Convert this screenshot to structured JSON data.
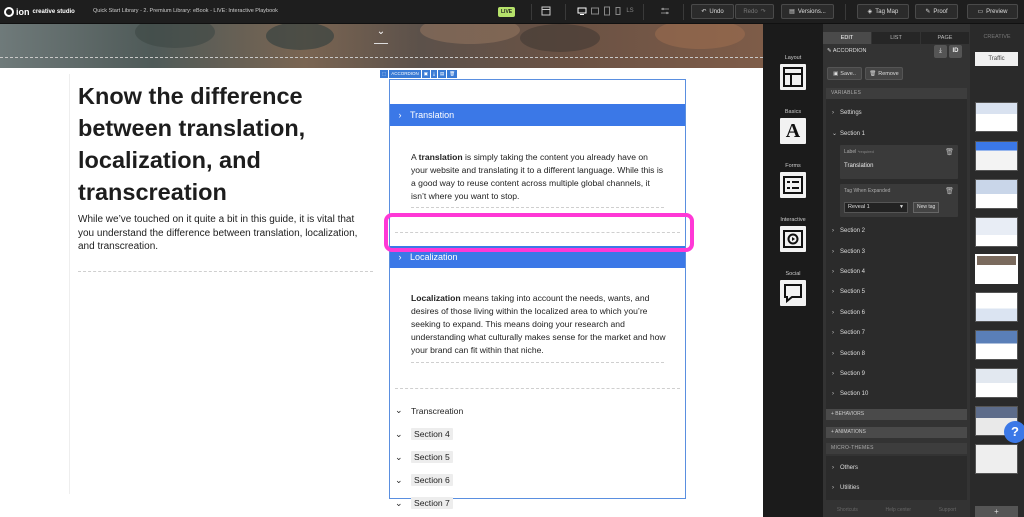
{
  "app": {
    "logo_word": "ion",
    "logo_sub": "creative studio",
    "breadcrumb": "Quick Start Library - 2. Premium Library: eBook - LIVE: Interactive Playbook",
    "live_badge": "LIVE"
  },
  "toolbar": {
    "viewport_label": "LS",
    "undo_label": "Undo",
    "redo_label": "Redo",
    "versions_label": "Versions...",
    "tagmap_label": "Tag Map",
    "proof_label": "Proof",
    "preview_label": "Preview"
  },
  "content": {
    "heading": "Know the difference between translation, localization, and transcreation",
    "intro": "While we’ve touched on it quite a bit in this guide, it is vital that you understand the difference between translation, localization, and transcreation."
  },
  "accordion": {
    "tag_label": "ACCORDION",
    "sections": [
      {
        "title": "Translation",
        "term": "translation",
        "before": "A ",
        "after": " is simply taking the content you already have on your website and translating it to a different language. While this is a good way to reuse content across multiple global channels, it isn’t where you want to stop."
      },
      {
        "title": "Localization",
        "term": "Localization",
        "before": "",
        "after": " means taking into account the needs, wants, and desires of those living within the localized area to which you’re seeking to expand. This means doing your research and understanding what culturally makes sense for the market and how your brand can fit within that niche."
      }
    ],
    "collapsed_items": [
      "Transcreation",
      "Section 4",
      "Section 5",
      "Section 6",
      "Section 7"
    ]
  },
  "rail": {
    "items": [
      {
        "label": "Layout",
        "icon": "layout-icon"
      },
      {
        "label": "Basics",
        "icon": "text-icon"
      },
      {
        "label": "Forms",
        "icon": "form-icon"
      },
      {
        "label": "Interactive",
        "icon": "play-icon"
      },
      {
        "label": "Social",
        "icon": "chat-icon"
      }
    ]
  },
  "panel": {
    "tabs": [
      "EDIT",
      "LIST",
      "PAGE"
    ],
    "active_tab": "EDIT",
    "element_title": "ACCORDION",
    "id_badge": "ID",
    "save_label": "Save..",
    "remove_label": "Remove",
    "variables_header": "VARIABLES",
    "settings_label": "Settings",
    "section1_label": "Section 1",
    "label_field_label": "Label",
    "label_field_required": "*required",
    "label_field_value": "Translation",
    "tag_field_label": "Tag When Expanded",
    "tag_select_value": "Reveal 1",
    "new_tag_label": "New tag",
    "sections": [
      "Section 2",
      "Section 3",
      "Section 4",
      "Section 5",
      "Section 6",
      "Section 7",
      "Section 8",
      "Section 9",
      "Section 10"
    ],
    "behaviors_label": "+ BEHAVIORS",
    "animations_label": "+ ANIMATIONS",
    "micro_themes_label": "MICRO-THEMES",
    "others_label": "Others",
    "utilities_label": "Utilities",
    "footer": [
      "Shortcuts",
      "Help center",
      "Support"
    ]
  },
  "thumbnails": {
    "creative_label": "CREATIVE",
    "traffic_label": "Traffic",
    "add_label": "+"
  },
  "help_label": "?"
}
